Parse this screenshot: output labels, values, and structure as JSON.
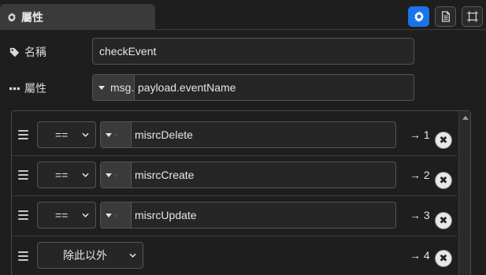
{
  "header": {
    "tab_label": "屬性",
    "buttons": [
      {
        "icon": "gear-icon",
        "active": true
      },
      {
        "icon": "document-icon",
        "active": false
      },
      {
        "icon": "frame-icon",
        "active": false
      }
    ]
  },
  "form": {
    "name_label": "名稱",
    "name_value": "checkEvent",
    "property_label": "屬性",
    "property_type": "msg.",
    "property_value": "payload.eventName"
  },
  "rules": [
    {
      "operator": "==",
      "value": "misrcDelete",
      "output": "→ 1"
    },
    {
      "operator": "==",
      "value": "misrcCreate",
      "output": "→ 2"
    },
    {
      "operator": "==",
      "value": "misrcUpdate",
      "output": "→ 3"
    },
    {
      "operator": "除此以外",
      "value": null,
      "output": "→ 4"
    }
  ],
  "colors": {
    "accent": "#1a73e8",
    "background": "#1e1e1e",
    "field_bg": "#262626",
    "border": "#555555"
  }
}
